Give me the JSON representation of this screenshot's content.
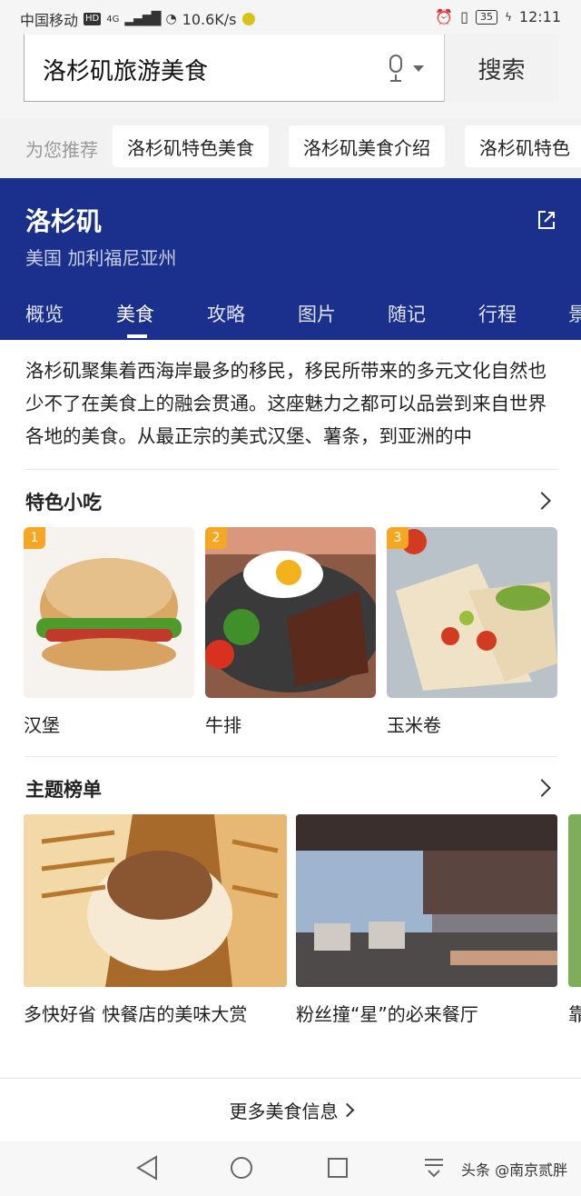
{
  "status_bar": {
    "carrier": "中国移动",
    "hd": "HD",
    "network": "4G",
    "speed": "10.6K/s",
    "battery": "35",
    "time": "12:11"
  },
  "search": {
    "query": "洛杉矶旅游美食",
    "button": "搜索"
  },
  "recommend": {
    "label": "为您推荐",
    "chips": [
      "洛杉矶特色美食",
      "洛杉矶美食介绍",
      "洛杉矶特色"
    ]
  },
  "header": {
    "city": "洛杉矶",
    "region": "美国  加利福尼亚州",
    "tabs": [
      "概览",
      "美食",
      "攻略",
      "图片",
      "随记",
      "行程",
      "景"
    ],
    "active_tab": "美食"
  },
  "intro": "洛杉矶聚集着西海岸最多的移民，移民所带来的多元文化自然也少不了在美食上的融会贯通。这座魅力之都可以品尝到来自世界各地的美食。从最正宗的美式汉堡、薯条，到亚洲的中",
  "snacks": {
    "title": "特色小吃",
    "items": [
      {
        "rank": "1",
        "name": "汉堡"
      },
      {
        "rank": "2",
        "name": "牛排"
      },
      {
        "rank": "3",
        "name": "玉米卷"
      }
    ]
  },
  "themes": {
    "title": "主题榜单",
    "items": [
      {
        "name": "多快好省 快餐店的美味大赏"
      },
      {
        "name": "粉丝撞“星”的必来餐厅"
      },
      {
        "name": "靠"
      }
    ]
  },
  "more": "更多美食信息",
  "watermark": "头条 @南京贰胖",
  "colors": {
    "header_bg": "#1b2f8d",
    "rank_badge": "#f5a623"
  }
}
